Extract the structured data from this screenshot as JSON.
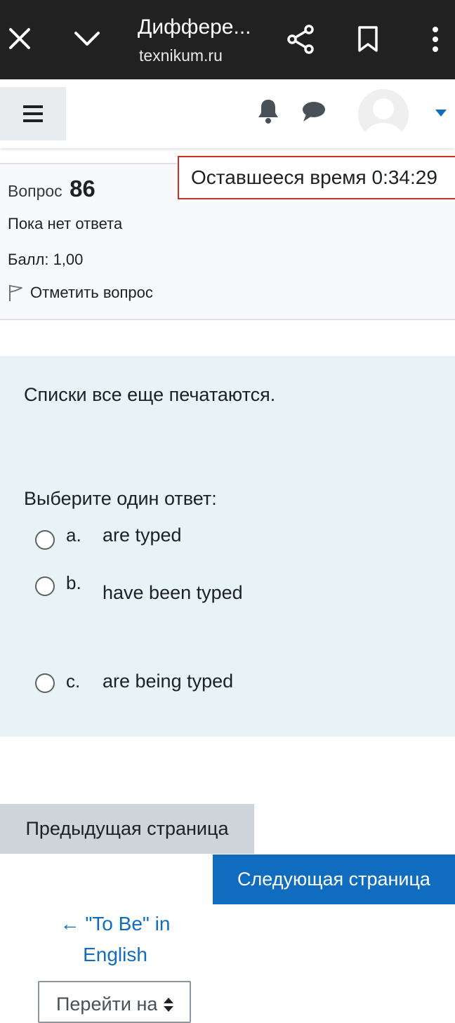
{
  "browser": {
    "title": "Диффере...",
    "url": "texnikum.ru",
    "icons": [
      "close-icon",
      "chevron-down-icon",
      "share-icon",
      "bookmark-icon",
      "more-vert-icon"
    ]
  },
  "navbar": {
    "icons": [
      "menu-icon",
      "bell-icon",
      "chat-icon",
      "avatar",
      "caret-down-icon"
    ],
    "accent": "#0f6cbf"
  },
  "question": {
    "label": "Вопрос",
    "number": "86",
    "state": "Пока нет ответа",
    "grade": "Балл: 1,00",
    "flag_label": "Отметить вопрос"
  },
  "timer": {
    "text": "Оставшееся время 0:34:29"
  },
  "content": {
    "text": "Списки все еще печатаются.",
    "prompt": "Выберите один ответ:",
    "options": [
      {
        "letter": "a.",
        "text": "are typed"
      },
      {
        "letter": "b.",
        "text": "have been typed"
      },
      {
        "letter": "c.",
        "text": "are being typed"
      }
    ]
  },
  "navigation": {
    "prev_label": "Предыдущая страница",
    "next_label": "Следующая страница",
    "back_link_line1": "← \"To Be\" in",
    "back_link_line2": "English",
    "jump_label": "Перейти на..."
  },
  "colors": {
    "topbar": "#212121",
    "content_bg": "#e7f3f5",
    "timer_border": "#ca3120",
    "primary_button": "#0f6cbf",
    "secondary_button": "#ced4da"
  }
}
